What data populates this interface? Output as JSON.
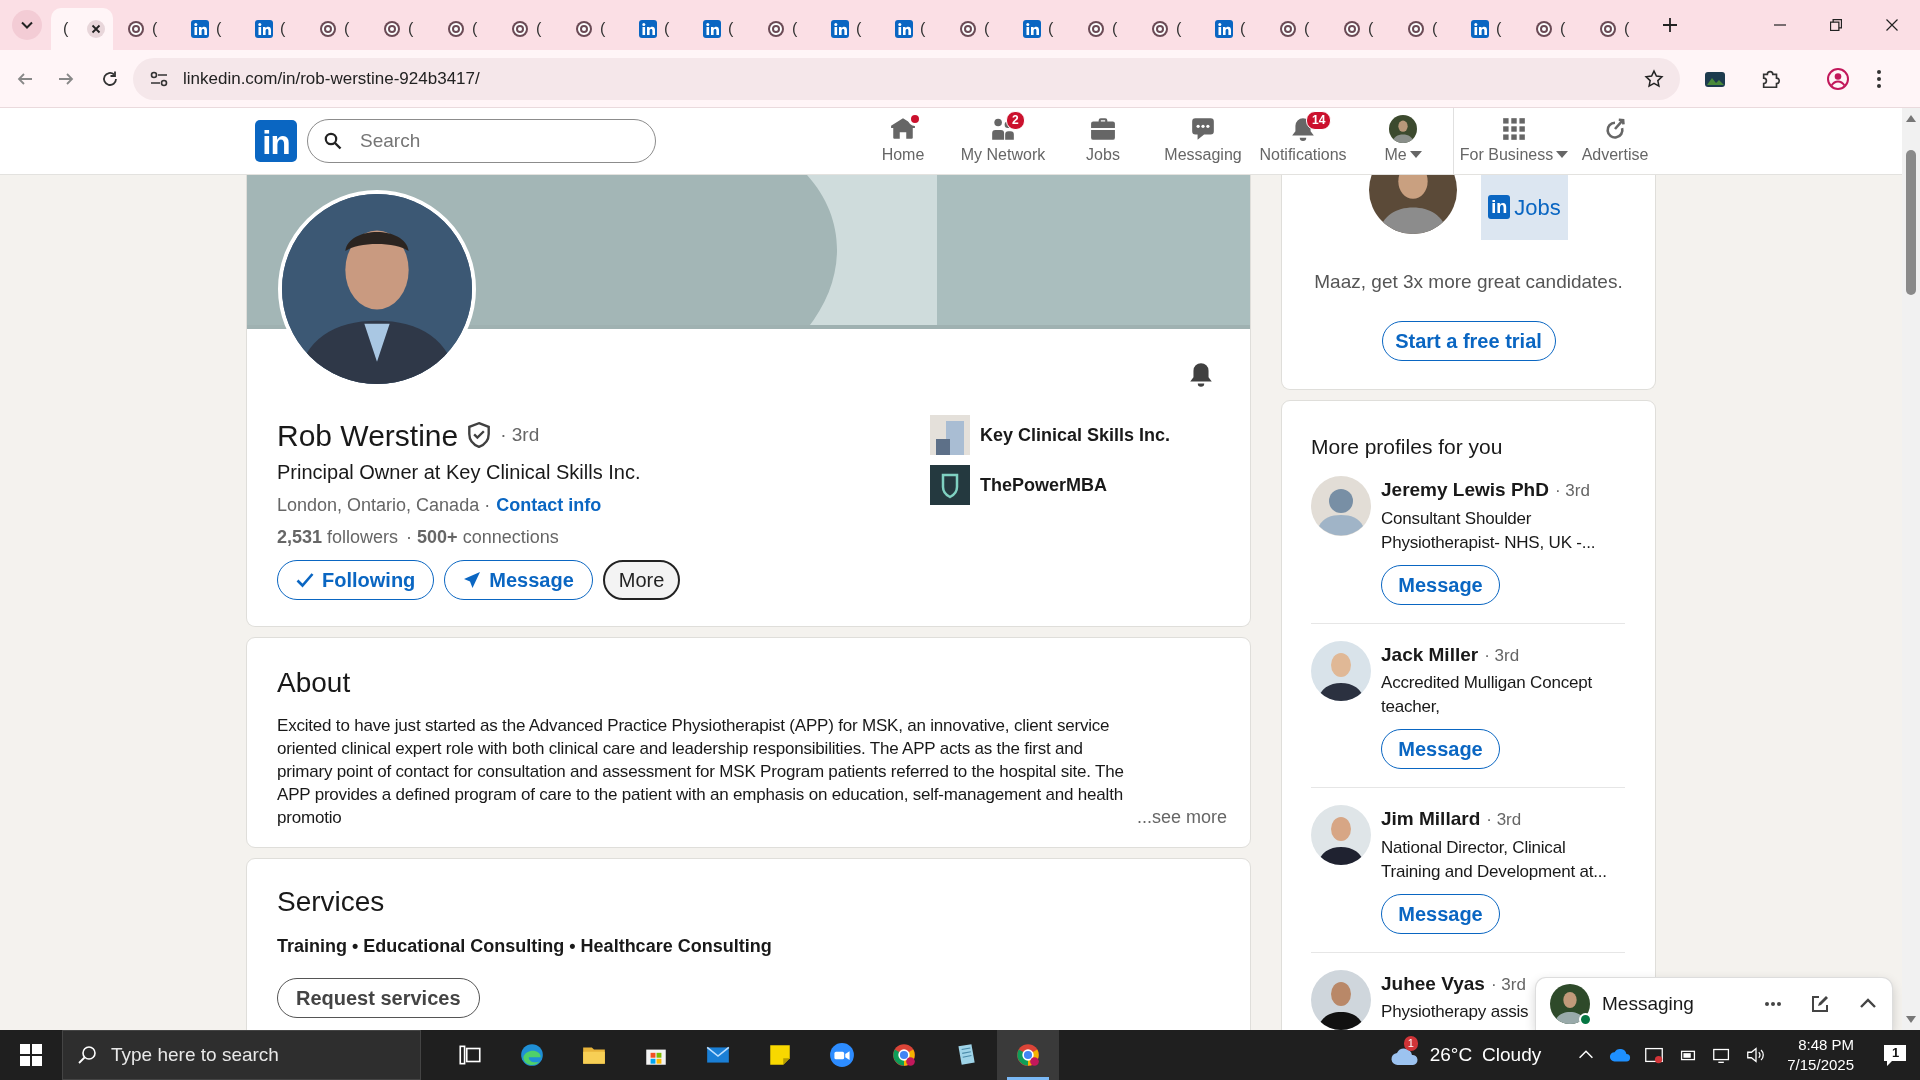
{
  "browser": {
    "tabs": [
      {
        "kind": "active",
        "label": "(",
        "selected": true
      },
      {
        "kind": "site",
        "label": "(",
        "selected": false
      },
      {
        "kind": "linkedin",
        "label": "(",
        "selected": false
      },
      {
        "kind": "linkedin",
        "label": "(",
        "selected": false
      },
      {
        "kind": "site",
        "label": "(",
        "selected": false
      },
      {
        "kind": "site",
        "label": "(",
        "selected": false
      },
      {
        "kind": "site",
        "label": "(",
        "selected": false
      },
      {
        "kind": "site",
        "label": "(",
        "selected": false
      },
      {
        "kind": "site",
        "label": "(",
        "selected": false
      },
      {
        "kind": "linkedin",
        "label": "(",
        "selected": false
      },
      {
        "kind": "linkedin",
        "label": "(",
        "selected": false
      },
      {
        "kind": "site",
        "label": "(",
        "selected": false
      },
      {
        "kind": "linkedin",
        "label": "(",
        "selected": false
      },
      {
        "kind": "linkedin",
        "label": "(",
        "selected": false
      },
      {
        "kind": "site",
        "label": "(",
        "selected": false
      },
      {
        "kind": "linkedin",
        "label": "(",
        "selected": false
      },
      {
        "kind": "site",
        "label": "(",
        "selected": false
      },
      {
        "kind": "site",
        "label": "(",
        "selected": false
      },
      {
        "kind": "linkedin",
        "label": "(",
        "selected": false
      },
      {
        "kind": "site",
        "label": "(",
        "selected": false
      },
      {
        "kind": "site",
        "label": "(",
        "selected": false
      },
      {
        "kind": "site",
        "label": "(",
        "selected": false
      },
      {
        "kind": "linkedin",
        "label": "(",
        "selected": false
      },
      {
        "kind": "site",
        "label": "(",
        "selected": false
      },
      {
        "kind": "site",
        "label": "(",
        "selected": false
      }
    ],
    "address": "linkedin.com/in/rob-werstine-924b3417/"
  },
  "site_nav": {
    "logo": "in",
    "search": {
      "placeholder": "Search"
    },
    "items": [
      {
        "kind": "home",
        "label": "Home",
        "dot": true,
        "caret": false
      },
      {
        "kind": "network",
        "label": "My Network",
        "badge": "2",
        "dot": false,
        "caret": false
      },
      {
        "kind": "jobs",
        "label": "Jobs",
        "dot": false,
        "caret": false
      },
      {
        "kind": "messaging",
        "label": "Messaging",
        "dot": false,
        "caret": false
      },
      {
        "kind": "notifications",
        "label": "Notifications",
        "badge": "14",
        "dot": false,
        "caret": false
      },
      {
        "kind": "me",
        "label": "Me",
        "dot": false,
        "caret": true
      },
      {
        "kind": "business",
        "label": "For Business",
        "dot": false,
        "caret": true
      },
      {
        "kind": "advertise",
        "label": "Advertise",
        "dot": false,
        "caret": false
      }
    ]
  },
  "profile": {
    "name": "Rob Werstine",
    "verified": true,
    "degree": "· 3rd",
    "headline": "Principal Owner at Key Clinical Skills Inc.",
    "location": "London, Ontario, Canada ·",
    "contact_link": "Contact info",
    "followers": "**2,531** followers",
    "connections": "· **500+** connections",
    "buttons": [
      {
        "kind": "following",
        "label": "Following"
      },
      {
        "kind": "message",
        "label": "Message"
      },
      {
        "kind": "more",
        "label": "More"
      }
    ],
    "companies": [
      {
        "name": "Key Clinical Skills Inc.",
        "kind": "blocks"
      },
      {
        "name": "ThePowerMBA",
        "kind": "shield"
      }
    ]
  },
  "about": {
    "title": "About",
    "text": "Excited to have just started as the Advanced Practice Physiotherapist (APP) for MSK, an innovative, client service oriented clinical expert role with both clinical care and leadership responsibilities. The APP acts as the first and primary point of contact for consultation and assessment for MSK Program patients referred to the hospital site. The APP provides a defined program of care to the patient with an emphasis on education, self-management and health promotio",
    "see_more": "...see more"
  },
  "services": {
    "title": "Services",
    "list": "Training • Educational Consulting • Healthcare Consulting",
    "button": "Request services"
  },
  "ad": {
    "logo_mark": "in",
    "logo_text": "Jobs",
    "text": "Maaz, get 3x more great candidates.",
    "button": "Start a free trial"
  },
  "more_profiles": {
    "title": "More profiles for you",
    "people": [
      {
        "name": "Jeremy Lewis PhD",
        "degree": "· 3rd",
        "headline": "Consultant Shoulder Physiotherapist- NHS, UK -...",
        "button": "Message",
        "kind": "placeholder"
      },
      {
        "name": "Jack Miller",
        "degree": "· 3rd",
        "headline": "Accredited Mulligan Concept teacher,",
        "button": "Message"
      },
      {
        "name": "Jim Millard",
        "degree": "· 3rd",
        "headline": "National Director, Clinical Training and Development at...",
        "button": "Message"
      },
      {
        "name": "Juhee Vyas",
        "degree": "· 3rd",
        "headline": "Physiotherapy assis"
      }
    ]
  },
  "messaging": {
    "title": "Messaging",
    "online": true
  },
  "taskbar": {
    "search": {
      "placeholder": "Type here to search"
    },
    "apps": [
      {
        "kind": "taskview",
        "selected": false
      },
      {
        "kind": "edge",
        "selected": false
      },
      {
        "kind": "folder",
        "selected": false
      },
      {
        "kind": "store",
        "selected": false
      },
      {
        "kind": "mail",
        "selected": false
      },
      {
        "kind": "notes",
        "selected": false
      },
      {
        "kind": "zoom",
        "selected": false
      },
      {
        "kind": "chrome",
        "selected": false
      },
      {
        "kind": "pad",
        "selected": false
      },
      {
        "kind": "chrome",
        "selected": true
      }
    ],
    "weather": {
      "alert": "1",
      "temperature": "26°C",
      "condition": "Cloudy"
    },
    "time": "8:48 PM",
    "date": "7/15/2025",
    "notifications": "1"
  }
}
